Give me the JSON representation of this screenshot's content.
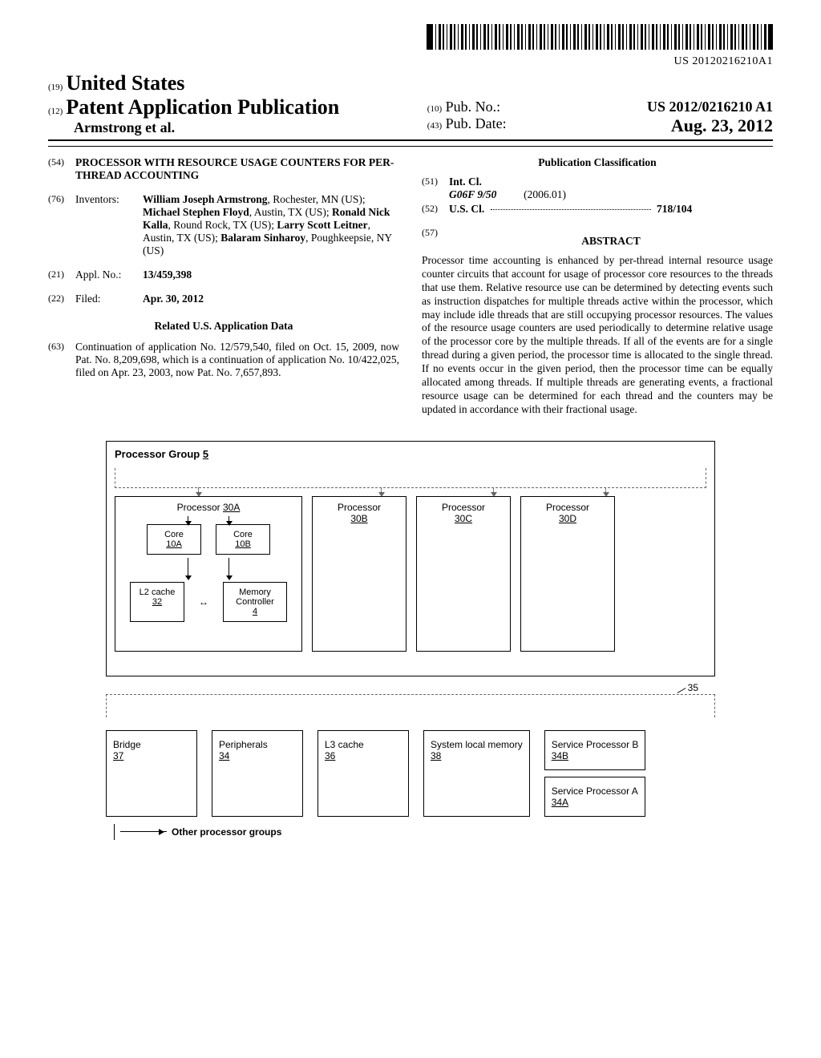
{
  "barcode_number": "US 20120216210A1",
  "header": {
    "code19": "(19)",
    "country": "United States",
    "code12": "(12)",
    "pub_type": "Patent Application Publication",
    "authors_line": "Armstrong et al.",
    "code10": "(10)",
    "pub_no_label": "Pub. No.:",
    "pub_no": "US 2012/0216210 A1",
    "code43": "(43)",
    "pub_date_label": "Pub. Date:",
    "pub_date": "Aug. 23, 2012"
  },
  "left_column": {
    "code54": "(54)",
    "title": "PROCESSOR WITH RESOURCE USAGE COUNTERS FOR PER-THREAD ACCOUNTING",
    "code76": "(76)",
    "inventors_label": "Inventors:",
    "inventors_html": "William Joseph Armstrong, Rochester, MN (US); Michael Stephen Floyd, Austin, TX (US); Ronald Nick Kalla, Round Rock, TX (US); Larry Scott Leitner, Austin, TX (US); Balaram Sinharoy, Poughkeepsie, NY (US)",
    "inventors": [
      {
        "name": "William Joseph Armstrong",
        "loc": "Rochester, MN (US)"
      },
      {
        "name": "Michael Stephen Floyd",
        "loc": "Austin, TX (US)"
      },
      {
        "name": "Ronald Nick Kalla",
        "loc": "Round Rock, TX (US)"
      },
      {
        "name": "Larry Scott Leitner",
        "loc": "Austin, TX (US)"
      },
      {
        "name": "Balaram Sinharoy",
        "loc": "Poughkeepsie, NY (US)"
      }
    ],
    "code21": "(21)",
    "appl_no_label": "Appl. No.:",
    "appl_no": "13/459,398",
    "code22": "(22)",
    "filed_label": "Filed:",
    "filed": "Apr. 30, 2012",
    "related_header": "Related U.S. Application Data",
    "code63": "(63)",
    "related_text": "Continuation of application No. 12/579,540, filed on Oct. 15, 2009, now Pat. No. 8,209,698, which is a continuation of application No. 10/422,025, filed on Apr. 23, 2003, now Pat. No. 7,657,893."
  },
  "right_column": {
    "class_header": "Publication Classification",
    "code51": "(51)",
    "intcl_label": "Int. Cl.",
    "intcl_code": "G06F 9/50",
    "intcl_date": "(2006.01)",
    "code52": "(52)",
    "uscl_label": "U.S. Cl.",
    "uscl_value": "718/104",
    "code57": "(57)",
    "abstract_label": "ABSTRACT",
    "abstract_text": "Processor time accounting is enhanced by per-thread internal resource usage counter circuits that account for usage of processor core resources to the threads that use them. Relative resource use can be determined by detecting events such as instruction dispatches for multiple threads active within the processor, which may include idle threads that are still occupying processor resources. The values of the resource usage counters are used periodically to determine relative usage of the processor core by the multiple threads. If all of the events are for a single thread during a given period, the processor time is allocated to the single thread. If no events occur in the given period, then the processor time can be equally allocated among threads. If multiple threads are generating events, a fractional resource usage can be determined for each thread and the counters may be updated in accordance with their fractional usage."
  },
  "figure": {
    "group_label": "Processor Group",
    "group_num": "5",
    "proc_a": "Processor",
    "proc_a_num": "30A",
    "proc_b": "Processor",
    "proc_b_num": "30B",
    "proc_c": "Processor",
    "proc_c_num": "30C",
    "proc_d": "Processor",
    "proc_d_num": "30D",
    "core_a": "Core",
    "core_a_num": "10A",
    "core_b": "Core",
    "core_b_num": "10B",
    "l2": "L2 cache",
    "l2_num": "32",
    "memctl": "Memory Controller",
    "memctl_num": "4",
    "bus_label": "35",
    "bridge": "Bridge",
    "bridge_num": "37",
    "periph": "Peripherals",
    "periph_num": "34",
    "l3": "L3 cache",
    "l3_num": "36",
    "sysmem": "System local memory",
    "sysmem_num": "38",
    "svc_b": "Service Processor B",
    "svc_b_num": "34B",
    "svc_a": "Service Processor A",
    "svc_a_num": "34A",
    "other": "Other processor groups"
  }
}
